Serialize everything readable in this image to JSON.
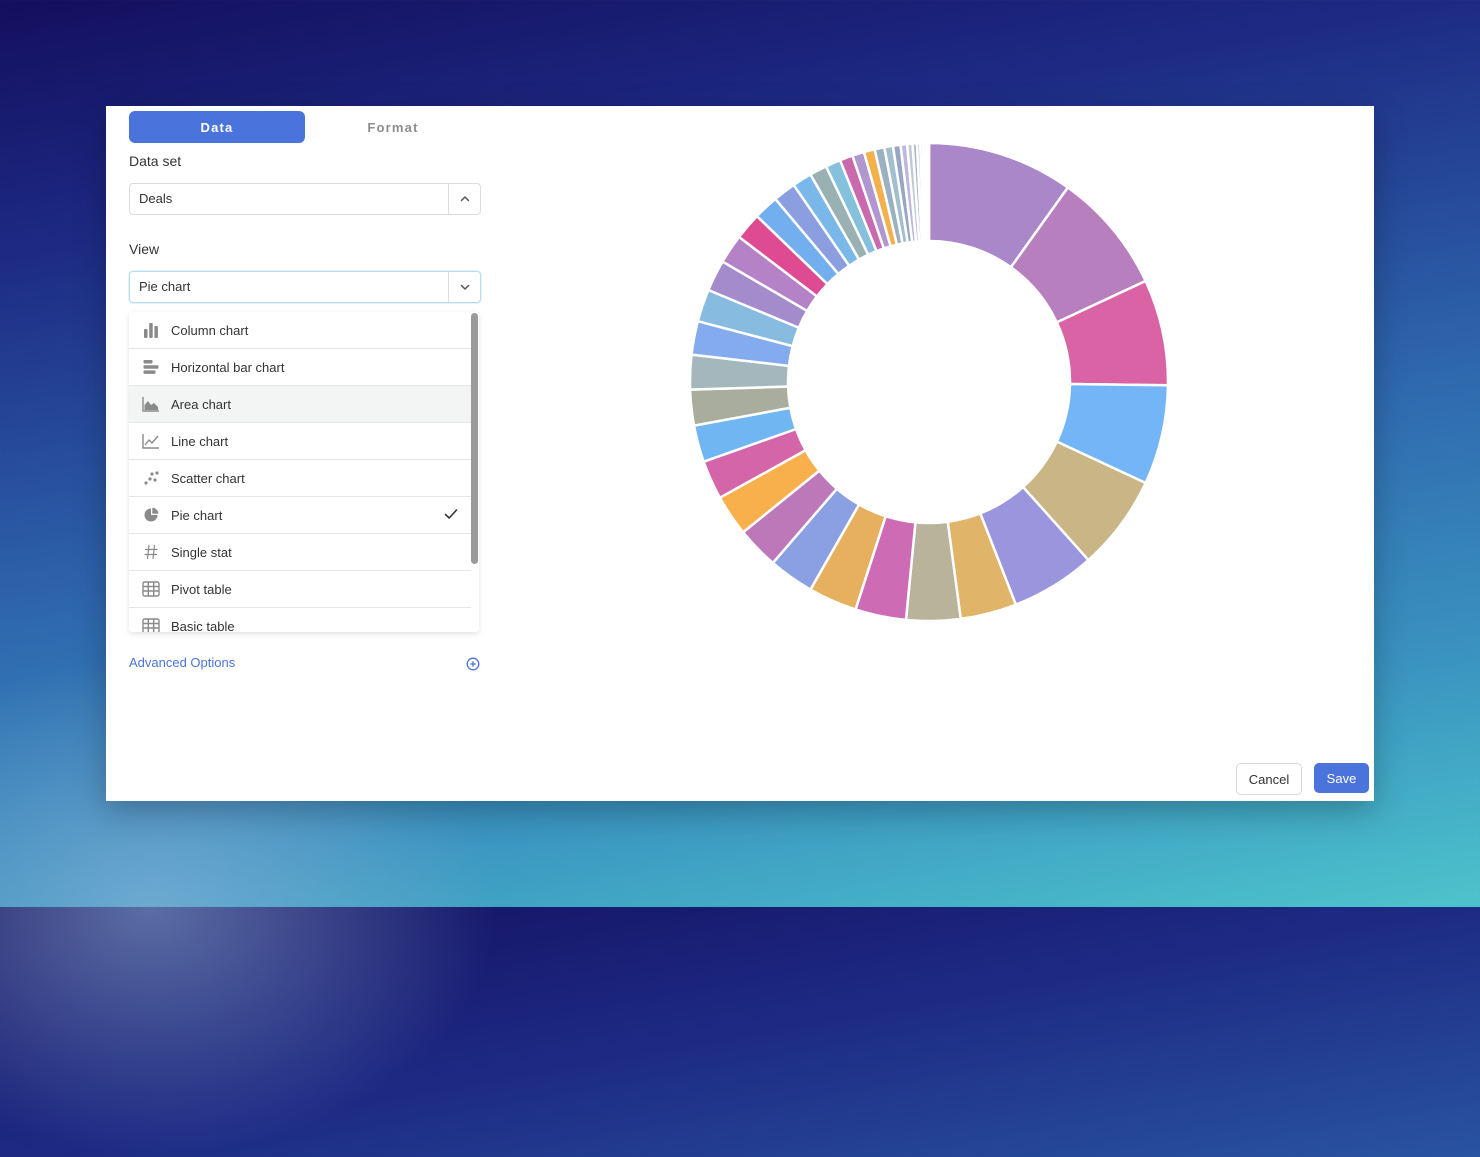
{
  "tabs": {
    "data": "Data",
    "format": "Format"
  },
  "dataset": {
    "label": "Data set",
    "value": "Deals"
  },
  "view": {
    "label": "View",
    "value": "Pie chart",
    "options": [
      {
        "label": "Column chart",
        "icon": "column-chart-icon"
      },
      {
        "label": "Horizontal bar chart",
        "icon": "horizontal-bar-chart-icon"
      },
      {
        "label": "Area chart",
        "icon": "area-chart-icon"
      },
      {
        "label": "Line chart",
        "icon": "line-chart-icon"
      },
      {
        "label": "Scatter chart",
        "icon": "scatter-chart-icon"
      },
      {
        "label": "Pie chart",
        "icon": "pie-chart-icon"
      },
      {
        "label": "Single stat",
        "icon": "hash-icon"
      },
      {
        "label": "Pivot table",
        "icon": "table-icon"
      },
      {
        "label": "Basic table",
        "icon": "table-icon"
      }
    ],
    "selected_index": 5,
    "hover_index": 2
  },
  "advanced_options": "Advanced Options",
  "buttons": {
    "cancel": "Cancel",
    "save": "Save"
  },
  "colors": {
    "accent": "#4a74dc"
  },
  "chart_data": {
    "type": "pie",
    "style": "donut",
    "values": [
      13.5,
      11.2,
      9.8,
      9.2,
      8.8,
      7.8,
      5.2,
      5.0,
      4.7,
      4.5,
      4.2,
      3.9,
      3.8,
      3.6,
      3.4,
      3.3,
      3.2,
      3.1,
      3.0,
      2.9,
      2.7,
      2.5,
      2.3,
      2.1,
      1.8,
      1.6,
      1.4,
      1.2,
      1.1,
      1.0,
      0.9,
      0.8,
      0.7,
      0.6,
      0.5,
      0.4,
      0.3,
      0.25,
      0.2,
      0.15,
      0.1,
      0.1
    ],
    "colors": [
      "#a987c9",
      "#b87fbe",
      "#d963a4",
      "#74b5f7",
      "#c9b585",
      "#9a95dc",
      "#e1b569",
      "#b8b39a",
      "#cd6bb4",
      "#e6b05f",
      "#8aa0e2",
      "#bd78b9",
      "#f8b04c",
      "#d465a9",
      "#6fb6f2",
      "#a9ad9d",
      "#a4b7bc",
      "#84abee",
      "#87bbe0",
      "#a48ccc",
      "#b581c7",
      "#de4b93",
      "#73aeee",
      "#8b9fe0",
      "#7ab8ea",
      "#9ab1b3",
      "#85c0dc",
      "#c96aae",
      "#b197cf",
      "#f4b04a",
      "#9bb0c0",
      "#a3bfcf",
      "#96a7c2",
      "#bdb8dc",
      "#c1c9d3",
      "#a9b6cc",
      "#bcc5cf",
      "#c4cad1",
      "#cfd4d9",
      "#d6dade",
      "#dcdfe3",
      "#e2e4e7"
    ]
  }
}
